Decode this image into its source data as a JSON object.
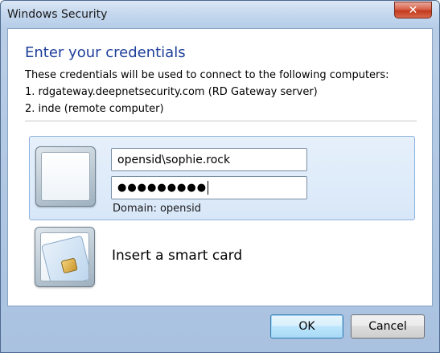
{
  "window": {
    "title": "Windows Security",
    "close_label": "✕"
  },
  "dialog": {
    "heading": "Enter your credentials",
    "description_lines": [
      "These credentials will be used to connect to the following computers:",
      "1. rdgateway.deepnetsecurity.com (RD Gateway server)",
      "2. inde (remote computer)"
    ]
  },
  "credential_tile": {
    "username_value": "opensid\\sophie.rock",
    "password_mask": "●●●●●●●●●",
    "domain_text": "Domain: opensid"
  },
  "smartcard_tile": {
    "label": "Insert a smart card"
  },
  "buttons": {
    "ok_label": "OK",
    "cancel_label": "Cancel"
  },
  "colors": {
    "heading": "#1e3f9a",
    "selected_tile_bg": "#dce9f8",
    "close_button": "#c94a2e"
  }
}
